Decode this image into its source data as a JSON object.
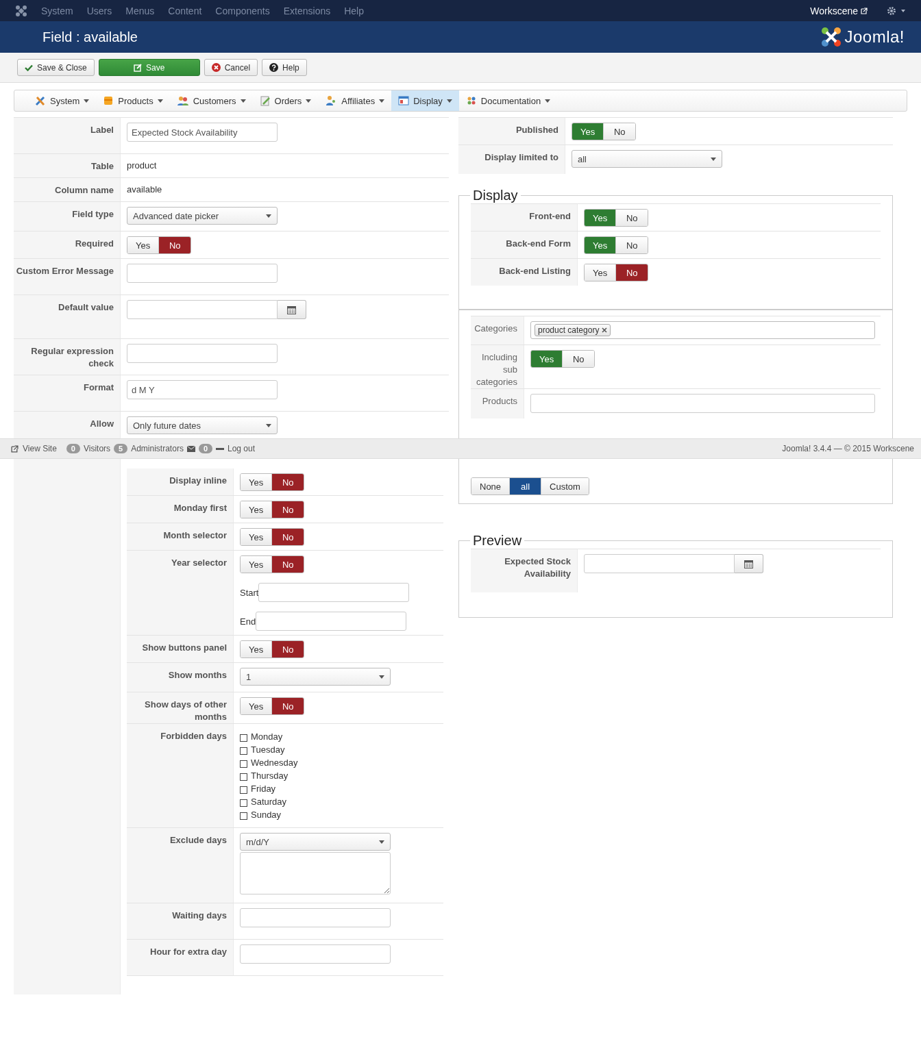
{
  "topbar": {
    "menu": [
      "System",
      "Users",
      "Menus",
      "Content",
      "Components",
      "Extensions",
      "Help"
    ],
    "site": "Workscene"
  },
  "header": {
    "title": "Field : available",
    "logo": "Joomla!"
  },
  "toolbar": [
    {
      "label": "Save & Close",
      "kind": "check"
    },
    {
      "label": "Save",
      "kind": "primary"
    },
    {
      "label": "Cancel",
      "kind": "cancel"
    },
    {
      "label": "Help",
      "kind": "help"
    }
  ],
  "submenu": [
    {
      "label": "System",
      "selected": false
    },
    {
      "label": "Products",
      "selected": false
    },
    {
      "label": "Customers",
      "selected": false
    },
    {
      "label": "Orders",
      "selected": false
    },
    {
      "label": "Affiliates",
      "selected": false
    },
    {
      "label": "Display",
      "selected": true
    },
    {
      "label": "Documentation",
      "selected": false
    }
  ],
  "left_fields": [
    {
      "kind": "input",
      "label": "Label",
      "value": "Expected Stock Availability"
    },
    {
      "kind": "text",
      "label": "Table",
      "value": "product"
    },
    {
      "kind": "text",
      "label": "Column name",
      "value": "available"
    },
    {
      "kind": "select",
      "label": "Field type",
      "value": "Advanced date picker"
    },
    {
      "kind": "toggle",
      "label": "Required",
      "options": [
        {
          "label": "Yes",
          "selected": false
        },
        {
          "label": "No",
          "selected": true
        }
      ]
    },
    {
      "kind": "input",
      "label": "Custom Error Message"
    },
    {
      "kind": "date",
      "label": "Default value"
    },
    {
      "kind": "input",
      "label": "Regular expression check"
    },
    {
      "kind": "input",
      "label": "Format",
      "value": "d M Y"
    },
    {
      "kind": "select",
      "label": "Allow",
      "value": "Only future dates"
    },
    {
      "kind": "group",
      "fields": [
        {
          "kind": "toggle",
          "label": "Display inline",
          "options": [
            {
              "label": "Yes",
              "selected": false
            },
            {
              "label": "No",
              "selected": true
            }
          ]
        },
        {
          "kind": "toggle",
          "label": "Monday first",
          "options": [
            {
              "label": "Yes",
              "selected": false
            },
            {
              "label": "No",
              "selected": true
            }
          ]
        },
        {
          "kind": "toggle",
          "label": "Month selector",
          "options": [
            {
              "label": "Yes",
              "selected": false
            },
            {
              "label": "No",
              "selected": true
            }
          ]
        },
        {
          "kind": "toggle",
          "label": "Year selector",
          "options": [
            {
              "label": "Yes",
              "selected": false
            },
            {
              "label": "No",
              "selected": true
            }
          ],
          "subfields": [
            {
              "label": "Start"
            },
            {
              "label": "End"
            }
          ]
        },
        {
          "kind": "toggle",
          "label": "Show buttons panel",
          "options": [
            {
              "label": "Yes",
              "selected": false
            },
            {
              "label": "No",
              "selected": true
            }
          ]
        },
        {
          "kind": "select",
          "label": "Show months",
          "value": "1"
        },
        {
          "kind": "toggle",
          "label": "Show days of other months",
          "options": [
            {
              "label": "Yes",
              "selected": false
            },
            {
              "label": "No",
              "selected": true
            }
          ]
        },
        {
          "kind": "checklist",
          "label": "Forbidden days",
          "items": [
            {
              "label": "Monday",
              "checked": false
            },
            {
              "label": "Tuesday",
              "checked": false
            },
            {
              "label": "Wednesday",
              "checked": false
            },
            {
              "label": "Thursday",
              "checked": false
            },
            {
              "label": "Friday",
              "checked": false
            },
            {
              "label": "Saturday",
              "checked": false
            },
            {
              "label": "Sunday",
              "checked": false
            }
          ]
        },
        {
          "kind": "select_textarea",
          "label": "Exclude days",
          "value": "m/d/Y"
        },
        {
          "kind": "input",
          "label": "Waiting days"
        },
        {
          "kind": "input",
          "label": "Hour for extra day"
        }
      ]
    }
  ],
  "right_fields": [
    {
      "kind": "toggle",
      "label": "Published",
      "options": [
        {
          "label": "Yes",
          "selected": true
        },
        {
          "label": "No",
          "selected": false
        }
      ]
    },
    {
      "kind": "select",
      "label": "Display limited to",
      "value": "all"
    }
  ],
  "display": {
    "title": "Display",
    "fields": [
      {
        "kind": "toggle",
        "label": "Front-end",
        "options": [
          {
            "label": "Yes",
            "selected": true
          },
          {
            "label": "No",
            "selected": false
          }
        ]
      },
      {
        "kind": "toggle",
        "label": "Back-end Form",
        "options": [
          {
            "label": "Yes",
            "selected": true
          },
          {
            "label": "No",
            "selected": false
          }
        ]
      },
      {
        "kind": "toggle",
        "label": "Back-end Listing",
        "options": [
          {
            "label": "Yes",
            "selected": false
          },
          {
            "label": "No",
            "selected": true
          }
        ]
      }
    ]
  },
  "filters": {
    "fields": [
      {
        "kind": "tags",
        "label": "Categories",
        "tags": [
          "product category"
        ]
      },
      {
        "kind": "toggle",
        "label": "Including sub categories",
        "options": [
          {
            "label": "Yes",
            "selected": true
          },
          {
            "label": "No",
            "selected": false
          }
        ]
      },
      {
        "kind": "wide_input",
        "label": "Products"
      }
    ]
  },
  "access": {
    "options": [
      {
        "label": "None",
        "selected": false
      },
      {
        "label": "all",
        "selected": true
      },
      {
        "label": "Custom",
        "selected": false
      }
    ]
  },
  "preview": {
    "title": "Preview",
    "fields": [
      {
        "kind": "date",
        "label": "Expected Stock Availability"
      }
    ]
  },
  "status_bar": {
    "view_site": "View Site",
    "visitors_count": "0",
    "visitors": "Visitors",
    "admins_count": "5",
    "admins": "Administrators",
    "messages_count": "0",
    "logout": "Log out",
    "version": "Joomla! 3.4.4 — © 2015 Workscene"
  }
}
